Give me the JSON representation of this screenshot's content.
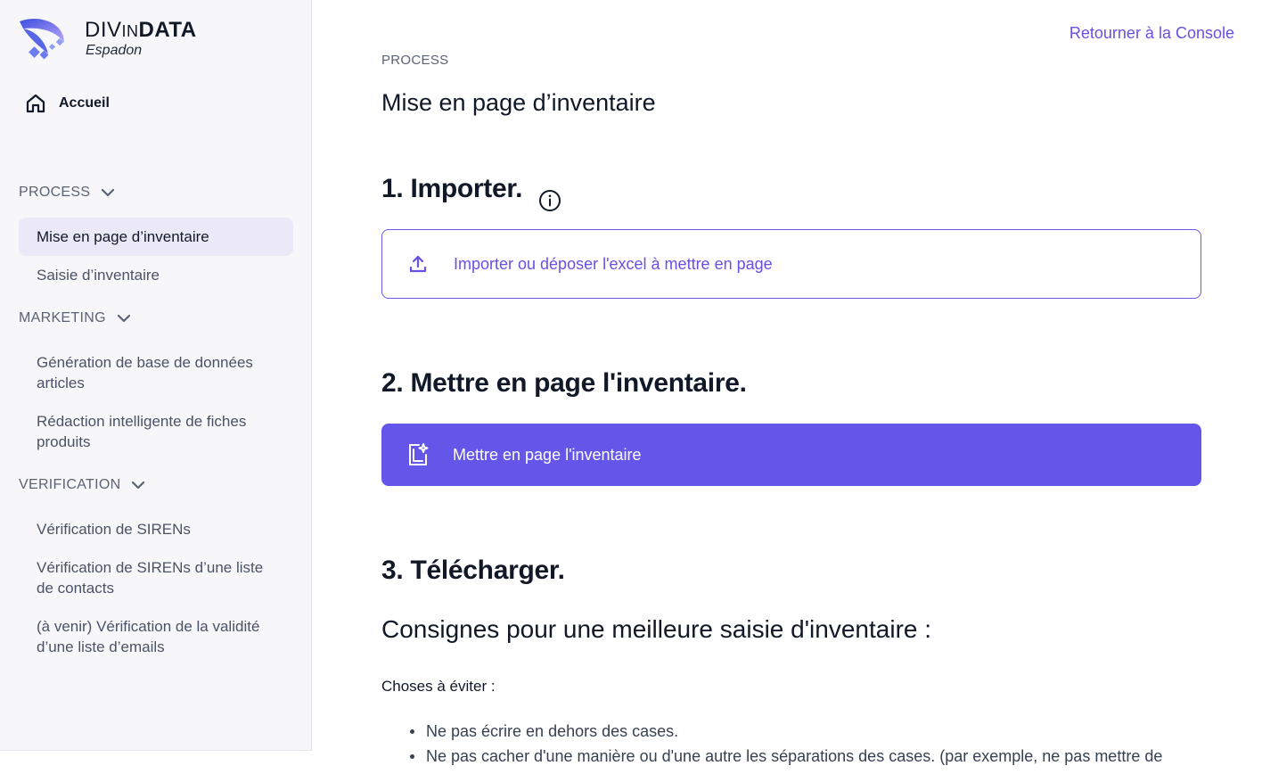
{
  "brand": {
    "name_part1": "DIV",
    "name_part2": "IN",
    "name_part3": "DATA",
    "subtitle": "Espadon"
  },
  "sidebar": {
    "home_label": "Accueil",
    "sections": [
      {
        "title": "PROCESS",
        "items": [
          "Mise en page d’inventaire",
          "Saisie d’inventaire"
        ]
      },
      {
        "title": "MARKETING",
        "items": [
          "Génération de base de données articles",
          "Rédaction intelligente de fiches produits"
        ]
      },
      {
        "title": "VERIFICATION",
        "items": [
          "Vérification de SIRENs",
          "Vérification de SIRENs d’une liste de contacts",
          "(à venir) Vérification de la validité d’une liste d’emails"
        ]
      }
    ],
    "active_item": "Mise en page d’inventaire"
  },
  "header": {
    "console_link": "Retourner à la Console"
  },
  "main": {
    "eyebrow": "PROCESS",
    "title": "Mise en page d’inventaire",
    "step1_title": "1. Importer.",
    "upload_label": "Importer ou déposer l'excel à mettre en page",
    "step2_title": "2. Mettre en page l'inventaire.",
    "layout_button_label": "Mettre en page l'inventaire",
    "step3_title": "3. Télécharger.",
    "guidelines_title": "Consignes pour une meilleure saisie d'inventaire :",
    "avoid_label": "Choses à éviter :",
    "avoid_items": [
      "Ne pas écrire en dehors des cases.",
      "Ne pas cacher d'une manière ou d'une autre les séparations des cases. (par exemple, ne pas mettre de"
    ]
  },
  "colors": {
    "accent": "#6556ea",
    "link": "#6650e6",
    "sidebar_bg": "#f7f7fa",
    "active_bg": "#ebe9f8"
  },
  "icons": [
    "logo-mark",
    "home-icon",
    "chevron-down-icon",
    "info-icon",
    "upload-icon",
    "layout-sparkle-icon"
  ]
}
